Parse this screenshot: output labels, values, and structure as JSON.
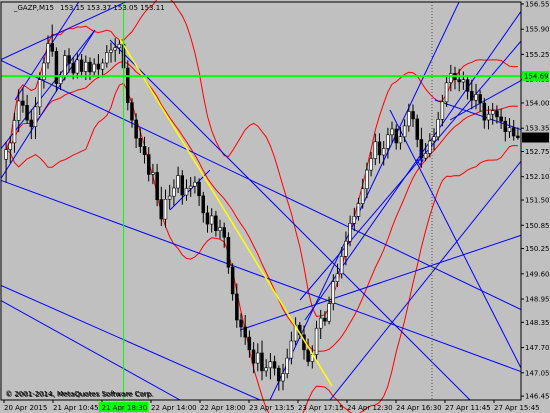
{
  "header": {
    "symbol": "_GAZP,M15",
    "ohlc": "153.15 153.37 153.05 153.11"
  },
  "copyright": "© 2001-2014, MetaQuotes Software Corp.",
  "copyright_shadow": "© 2001-2014, MetaQuotes Software Corp.",
  "colors": {
    "background": "#c0c0c0",
    "candle_up": "#ffffff",
    "candle_down": "#000000",
    "wick": "#000000",
    "candle_outline": "#000000",
    "bollinger": "#ff0000",
    "trendline": "#0000ff",
    "fib_line": "#ffff00",
    "crosshair": "#00ff00",
    "price_tag_current": "#000000",
    "price_tag_crosshair": "#00ff00",
    "dotted_vline": "#555555",
    "arrow": "#0000ff"
  },
  "chart_data": {
    "type": "candlestick",
    "title": "_GAZP,M15",
    "y_range": [
      146.35,
      156.6
    ],
    "y_ticks": [
      "156.55",
      "155.90",
      "155.25",
      "154.60",
      "154.00",
      "153.35",
      "152.75",
      "152.10",
      "151.50",
      "150.85",
      "150.25",
      "149.60",
      "148.95",
      "148.35",
      "147.70",
      "147.05",
      "146.45"
    ],
    "x_ticks": [
      "20 Apr 2015",
      "21 Apr 10:45",
      "21 Apr",
      "22 Apr 14:00",
      "22 Apr 18:00",
      "23 Apr 13:15",
      "23 Apr 17:15",
      "24 Apr 12:30",
      "24 Apr 16:30",
      "27 Apr 11:45",
      "27 Apr 15:45"
    ],
    "x_tick_crosshair": "21 Apr 18:30",
    "current_price": "153.11",
    "crosshair_price": "154.69",
    "crosshair": {
      "price": 154.69,
      "bar": 28
    },
    "candles": [
      {
        "o": 152.55,
        "h": 153.0,
        "l": 151.95,
        "c": 152.8
      },
      {
        "o": 152.8,
        "h": 153.15,
        "l": 152.45,
        "c": 152.97
      },
      {
        "o": 152.97,
        "h": 153.75,
        "l": 152.72,
        "c": 153.55
      },
      {
        "o": 153.55,
        "h": 154.35,
        "l": 153.25,
        "c": 154.05
      },
      {
        "o": 154.05,
        "h": 154.4,
        "l": 153.75,
        "c": 153.94
      },
      {
        "o": 153.94,
        "h": 154.21,
        "l": 153.46,
        "c": 153.56
      },
      {
        "o": 153.56,
        "h": 153.83,
        "l": 153.07,
        "c": 153.39
      },
      {
        "o": 153.39,
        "h": 154.15,
        "l": 153.07,
        "c": 153.9
      },
      {
        "o": 153.9,
        "h": 154.79,
        "l": 153.69,
        "c": 154.6
      },
      {
        "o": 154.6,
        "h": 155.17,
        "l": 154.37,
        "c": 155.03
      },
      {
        "o": 155.03,
        "h": 155.74,
        "l": 154.88,
        "c": 155.53
      },
      {
        "o": 155.53,
        "h": 156.02,
        "l": 155.19,
        "c": 155.33
      },
      {
        "o": 155.33,
        "h": 155.43,
        "l": 154.29,
        "c": 154.5
      },
      {
        "o": 154.5,
        "h": 154.81,
        "l": 154.33,
        "c": 154.68
      },
      {
        "o": 154.68,
        "h": 155.36,
        "l": 154.58,
        "c": 155.22
      },
      {
        "o": 155.22,
        "h": 155.41,
        "l": 154.78,
        "c": 155.02
      },
      {
        "o": 155.02,
        "h": 155.18,
        "l": 154.61,
        "c": 154.77
      },
      {
        "o": 154.77,
        "h": 155.28,
        "l": 154.63,
        "c": 155.11
      },
      {
        "o": 155.11,
        "h": 155.26,
        "l": 154.66,
        "c": 154.81
      },
      {
        "o": 154.81,
        "h": 155.22,
        "l": 154.59,
        "c": 155.05
      },
      {
        "o": 155.05,
        "h": 155.17,
        "l": 154.59,
        "c": 154.8
      },
      {
        "o": 154.8,
        "h": 155.15,
        "l": 154.69,
        "c": 155.0
      },
      {
        "o": 155.0,
        "h": 155.26,
        "l": 154.64,
        "c": 154.87
      },
      {
        "o": 154.87,
        "h": 155.14,
        "l": 154.66,
        "c": 155.03
      },
      {
        "o": 155.03,
        "h": 155.49,
        "l": 154.91,
        "c": 155.3
      },
      {
        "o": 155.3,
        "h": 155.55,
        "l": 155.04,
        "c": 155.36
      },
      {
        "o": 155.36,
        "h": 155.67,
        "l": 155.06,
        "c": 155.42
      },
      {
        "o": 155.42,
        "h": 155.67,
        "l": 155.26,
        "c": 155.51
      },
      {
        "o": 155.51,
        "h": 155.57,
        "l": 154.72,
        "c": 154.9
      },
      {
        "o": 154.9,
        "h": 155.1,
        "l": 153.81,
        "c": 154.01
      },
      {
        "o": 154.01,
        "h": 154.12,
        "l": 153.36,
        "c": 153.56
      },
      {
        "o": 153.56,
        "h": 153.73,
        "l": 152.84,
        "c": 153.09
      },
      {
        "o": 153.09,
        "h": 153.35,
        "l": 152.71,
        "c": 152.88
      },
      {
        "o": 152.88,
        "h": 153.13,
        "l": 152.44,
        "c": 152.67
      },
      {
        "o": 152.67,
        "h": 152.86,
        "l": 151.98,
        "c": 152.16
      },
      {
        "o": 152.16,
        "h": 152.43,
        "l": 151.91,
        "c": 152.21
      },
      {
        "o": 152.21,
        "h": 152.43,
        "l": 151.34,
        "c": 151.51
      },
      {
        "o": 151.51,
        "h": 151.84,
        "l": 150.83,
        "c": 151.01
      },
      {
        "o": 151.01,
        "h": 151.77,
        "l": 150.79,
        "c": 151.52
      },
      {
        "o": 151.52,
        "h": 151.89,
        "l": 151.26,
        "c": 151.6
      },
      {
        "o": 151.6,
        "h": 152.03,
        "l": 151.36,
        "c": 151.81
      },
      {
        "o": 151.81,
        "h": 152.36,
        "l": 151.68,
        "c": 152.13
      },
      {
        "o": 152.13,
        "h": 152.27,
        "l": 151.38,
        "c": 151.63
      },
      {
        "o": 151.63,
        "h": 152.03,
        "l": 151.48,
        "c": 151.8
      },
      {
        "o": 151.8,
        "h": 152.09,
        "l": 151.58,
        "c": 151.86
      },
      {
        "o": 151.86,
        "h": 152.11,
        "l": 151.67,
        "c": 151.96
      },
      {
        "o": 151.96,
        "h": 152.06,
        "l": 151.35,
        "c": 151.61
      },
      {
        "o": 151.61,
        "h": 151.71,
        "l": 150.92,
        "c": 151.17
      },
      {
        "o": 151.17,
        "h": 151.36,
        "l": 150.66,
        "c": 150.88
      },
      {
        "o": 150.88,
        "h": 151.29,
        "l": 150.66,
        "c": 151.09
      },
      {
        "o": 151.09,
        "h": 151.22,
        "l": 150.56,
        "c": 150.71
      },
      {
        "o": 150.71,
        "h": 150.99,
        "l": 150.5,
        "c": 150.79
      },
      {
        "o": 150.79,
        "h": 150.92,
        "l": 150.27,
        "c": 150.54
      },
      {
        "o": 150.54,
        "h": 150.67,
        "l": 149.6,
        "c": 149.77
      },
      {
        "o": 149.77,
        "h": 149.87,
        "l": 148.91,
        "c": 149.08
      },
      {
        "o": 149.08,
        "h": 149.35,
        "l": 148.21,
        "c": 148.41
      },
      {
        "o": 148.41,
        "h": 148.58,
        "l": 147.97,
        "c": 148.23
      },
      {
        "o": 148.23,
        "h": 148.54,
        "l": 147.77,
        "c": 147.97
      },
      {
        "o": 147.97,
        "h": 148.14,
        "l": 147.44,
        "c": 147.64
      },
      {
        "o": 147.64,
        "h": 147.84,
        "l": 147.04,
        "c": 147.3
      },
      {
        "o": 147.3,
        "h": 147.81,
        "l": 147.09,
        "c": 147.56
      },
      {
        "o": 147.56,
        "h": 147.88,
        "l": 146.86,
        "c": 147.1
      },
      {
        "o": 147.1,
        "h": 147.4,
        "l": 146.95,
        "c": 147.18
      },
      {
        "o": 147.18,
        "h": 147.56,
        "l": 146.88,
        "c": 147.34
      },
      {
        "o": 147.34,
        "h": 147.49,
        "l": 146.98,
        "c": 147.17
      },
      {
        "o": 147.17,
        "h": 147.24,
        "l": 146.59,
        "c": 146.84
      },
      {
        "o": 146.84,
        "h": 147.28,
        "l": 146.6,
        "c": 147.03
      },
      {
        "o": 147.03,
        "h": 147.67,
        "l": 146.91,
        "c": 147.43
      },
      {
        "o": 147.43,
        "h": 148.11,
        "l": 147.27,
        "c": 147.87
      },
      {
        "o": 147.87,
        "h": 148.48,
        "l": 147.76,
        "c": 148.28
      },
      {
        "o": 148.28,
        "h": 148.36,
        "l": 147.92,
        "c": 148.03
      },
      {
        "o": 148.03,
        "h": 148.27,
        "l": 147.39,
        "c": 147.64
      },
      {
        "o": 147.64,
        "h": 147.93,
        "l": 147.22,
        "c": 147.34
      },
      {
        "o": 147.34,
        "h": 147.76,
        "l": 147.16,
        "c": 147.52
      },
      {
        "o": 147.52,
        "h": 148.39,
        "l": 147.37,
        "c": 148.2
      },
      {
        "o": 148.2,
        "h": 148.67,
        "l": 147.92,
        "c": 148.46
      },
      {
        "o": 148.46,
        "h": 148.64,
        "l": 148.26,
        "c": 148.38
      },
      {
        "o": 148.38,
        "h": 149.01,
        "l": 148.3,
        "c": 148.83
      },
      {
        "o": 148.83,
        "h": 149.59,
        "l": 148.66,
        "c": 149.4
      },
      {
        "o": 149.4,
        "h": 149.86,
        "l": 149.26,
        "c": 149.6
      },
      {
        "o": 149.6,
        "h": 150.29,
        "l": 149.48,
        "c": 150.05
      },
      {
        "o": 150.05,
        "h": 150.69,
        "l": 149.82,
        "c": 150.44
      },
      {
        "o": 150.44,
        "h": 151.1,
        "l": 150.31,
        "c": 150.9
      },
      {
        "o": 150.9,
        "h": 151.3,
        "l": 150.7,
        "c": 151.08
      },
      {
        "o": 151.08,
        "h": 151.56,
        "l": 150.97,
        "c": 151.41
      },
      {
        "o": 151.41,
        "h": 152.05,
        "l": 151.28,
        "c": 151.79
      },
      {
        "o": 151.79,
        "h": 152.46,
        "l": 151.55,
        "c": 152.27
      },
      {
        "o": 152.27,
        "h": 152.74,
        "l": 152.11,
        "c": 152.57
      },
      {
        "o": 152.57,
        "h": 153.21,
        "l": 152.4,
        "c": 153.0
      },
      {
        "o": 153.0,
        "h": 153.22,
        "l": 152.44,
        "c": 152.66
      },
      {
        "o": 152.66,
        "h": 153.02,
        "l": 152.39,
        "c": 152.83
      },
      {
        "o": 152.83,
        "h": 153.36,
        "l": 152.57,
        "c": 153.18
      },
      {
        "o": 153.18,
        "h": 153.52,
        "l": 152.97,
        "c": 153.33
      },
      {
        "o": 153.33,
        "h": 153.45,
        "l": 152.8,
        "c": 152.97
      },
      {
        "o": 152.97,
        "h": 153.38,
        "l": 152.8,
        "c": 153.13
      },
      {
        "o": 153.13,
        "h": 153.58,
        "l": 152.99,
        "c": 153.41
      },
      {
        "o": 153.41,
        "h": 153.98,
        "l": 153.26,
        "c": 153.78
      },
      {
        "o": 153.78,
        "h": 153.96,
        "l": 153.38,
        "c": 153.59
      },
      {
        "o": 153.59,
        "h": 153.7,
        "l": 152.86,
        "c": 153.06
      },
      {
        "o": 153.06,
        "h": 153.36,
        "l": 152.33,
        "c": 152.58
      },
      {
        "o": 152.58,
        "h": 152.97,
        "l": 152.5,
        "c": 152.7
      },
      {
        "o": 152.7,
        "h": 153.22,
        "l": 152.6,
        "c": 153.02
      },
      {
        "o": 153.02,
        "h": 153.35,
        "l": 152.78,
        "c": 153.13
      },
      {
        "o": 153.13,
        "h": 153.77,
        "l": 153.03,
        "c": 153.58
      },
      {
        "o": 153.58,
        "h": 154.21,
        "l": 153.4,
        "c": 154.03
      },
      {
        "o": 154.03,
        "h": 154.72,
        "l": 153.9,
        "c": 154.52
      },
      {
        "o": 154.52,
        "h": 154.98,
        "l": 154.3,
        "c": 154.76
      },
      {
        "o": 154.76,
        "h": 154.93,
        "l": 154.35,
        "c": 154.6
      },
      {
        "o": 154.6,
        "h": 154.88,
        "l": 154.3,
        "c": 154.54
      },
      {
        "o": 154.54,
        "h": 154.81,
        "l": 154.34,
        "c": 154.6
      },
      {
        "o": 154.6,
        "h": 154.71,
        "l": 154.09,
        "c": 154.3
      },
      {
        "o": 154.3,
        "h": 154.6,
        "l": 153.84,
        "c": 154.07
      },
      {
        "o": 154.07,
        "h": 154.49,
        "l": 153.84,
        "c": 154.22
      },
      {
        "o": 154.22,
        "h": 154.33,
        "l": 153.78,
        "c": 154.0
      },
      {
        "o": 154.0,
        "h": 154.13,
        "l": 153.34,
        "c": 153.56
      },
      {
        "o": 153.56,
        "h": 153.92,
        "l": 153.32,
        "c": 153.71
      },
      {
        "o": 153.71,
        "h": 154.0,
        "l": 153.44,
        "c": 153.8
      },
      {
        "o": 153.8,
        "h": 153.94,
        "l": 153.47,
        "c": 153.64
      },
      {
        "o": 153.64,
        "h": 153.85,
        "l": 153.33,
        "c": 153.53
      },
      {
        "o": 153.53,
        "h": 153.64,
        "l": 153.01,
        "c": 153.26
      },
      {
        "o": 153.26,
        "h": 153.61,
        "l": 153.1,
        "c": 153.36
      },
      {
        "o": 153.36,
        "h": 153.56,
        "l": 153.03,
        "c": 153.15
      },
      {
        "o": 153.15,
        "h": 153.37,
        "l": 153.05,
        "c": 153.11
      }
    ]
  }
}
